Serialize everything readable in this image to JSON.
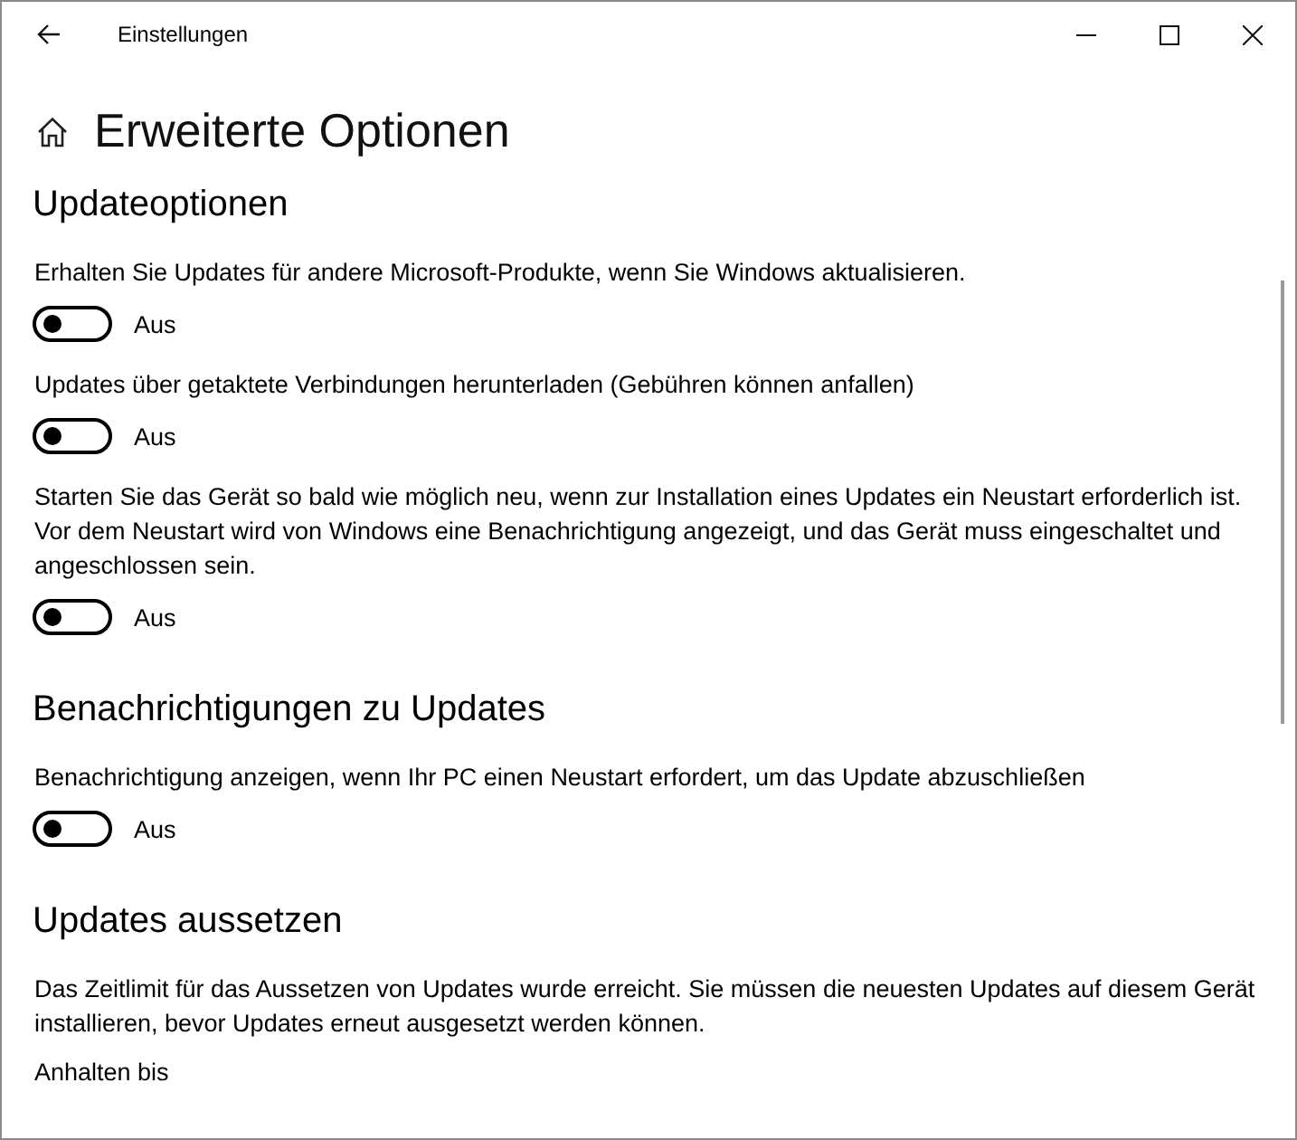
{
  "window": {
    "title": "Einstellungen"
  },
  "page_title": "Erweiterte Optionen",
  "sections": [
    {
      "heading": "Updateoptionen",
      "items": [
        {
          "kind": "toggle",
          "label": "Erhalten Sie Updates für andere Microsoft-Produkte, wenn Sie Windows aktualisieren.",
          "on": false,
          "state_text": "Aus"
        },
        {
          "kind": "toggle",
          "label": "Updates über getaktete Verbindungen herunterladen (Gebühren können anfallen)",
          "on": false,
          "state_text": "Aus"
        },
        {
          "kind": "toggle",
          "label": "Starten Sie das Gerät so bald wie möglich neu, wenn zur Installation eines Updates ein Neustart erforderlich ist. Vor dem Neustart wird von Windows eine Benachrichtigung angezeigt, und das Gerät muss eingeschaltet und angeschlossen sein.",
          "on": false,
          "state_text": "Aus"
        }
      ]
    },
    {
      "heading": "Benachrichtigungen zu Updates",
      "items": [
        {
          "kind": "toggle",
          "label": "Benachrichtigung anzeigen, wenn Ihr PC einen Neustart erfordert, um das Update abzuschließen",
          "on": false,
          "state_text": "Aus"
        }
      ]
    },
    {
      "heading": "Updates aussetzen",
      "items": [
        {
          "kind": "text",
          "label": "Das Zeitlimit für das Aussetzen von Updates wurde erreicht. Sie müssen die neuesten Updates auf diesem Gerät installieren, bevor Updates erneut ausgesetzt werden können."
        },
        {
          "kind": "caption",
          "label": "Anhalten bis"
        }
      ]
    }
  ]
}
